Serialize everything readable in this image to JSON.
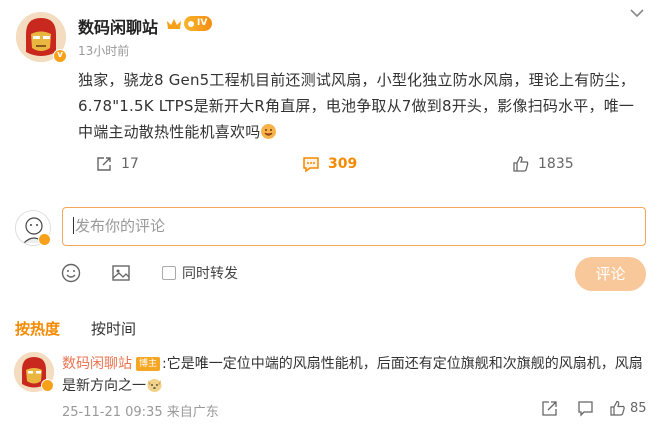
{
  "post": {
    "author": "数码闲聊站",
    "level": "IV",
    "time": "13小时前",
    "text": "独家，骁龙8 Gen5工程机目前还测试风扇，小型化独立防水风扇，理论上有防尘，6.78\"1.5K LTPS是新开大R角直屏，电池争取从7做到8开头，影像扫码水平，唯一中端主动散热性能机喜欢吗",
    "reposts": "17",
    "comments": "309",
    "likes": "1835"
  },
  "composer": {
    "placeholder": "发布你的评论",
    "repost_label": "同时转发",
    "submit_label": "评论"
  },
  "tabs": {
    "hot": "按热度",
    "time": "按时间"
  },
  "comment": {
    "author": "数码闲聊站",
    "badge": "博主",
    "text": ":它是唯一定位中端的风扇性能机，后面还有定位旗舰和次旗舰的风扇机，风扇是新方向之一",
    "date": "25-11-21 09:35",
    "location": "来自广东",
    "likes": "85"
  },
  "colors": {
    "accent": "#f48a00",
    "name": "#eb7350",
    "input_border": "#f5a65b",
    "send_disabled": "#f8c79a"
  }
}
